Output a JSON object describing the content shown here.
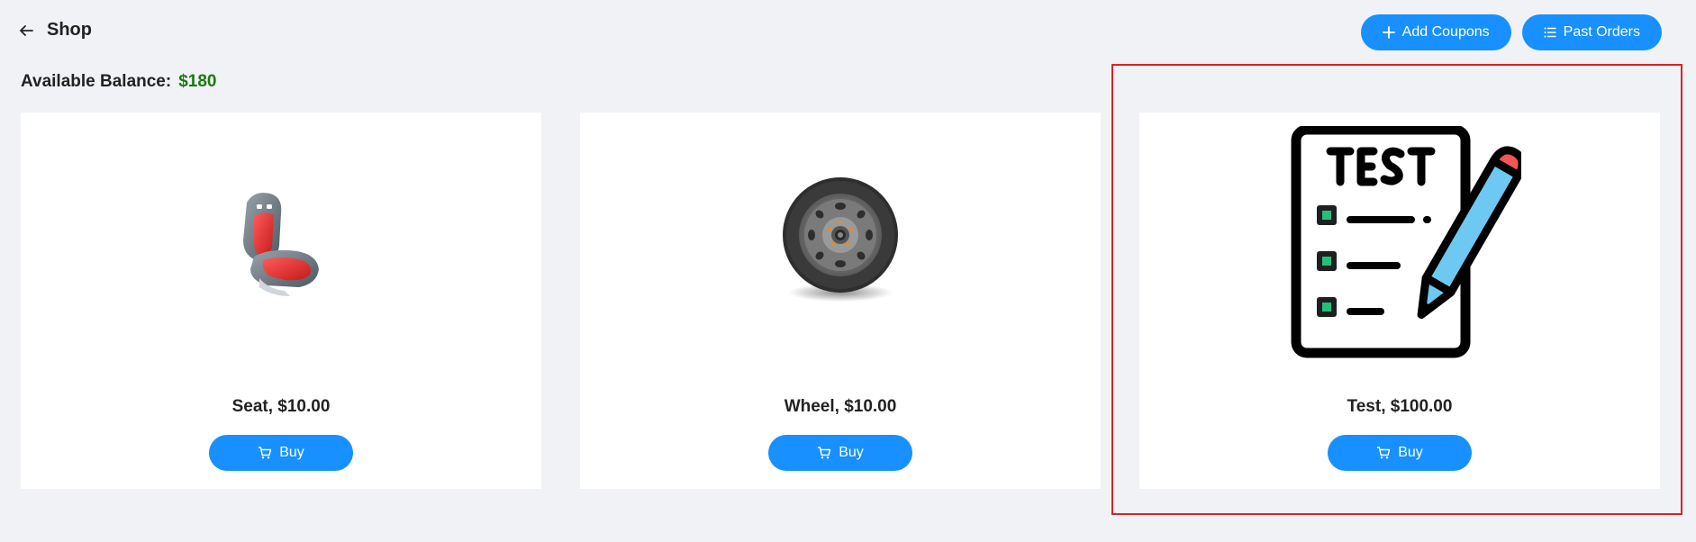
{
  "header": {
    "back_icon": "arrow-left-icon",
    "title": "Shop",
    "add_coupons_label": "Add Coupons",
    "add_coupons_icon": "plus-icon",
    "past_orders_label": "Past Orders",
    "past_orders_icon": "list-icon"
  },
  "balance": {
    "label": "Available Balance:",
    "amount": "$180"
  },
  "products": [
    {
      "title": "Seat, $10.00",
      "image_icon": "car-seat-icon",
      "buy_label": "Buy"
    },
    {
      "title": "Wheel, $10.00",
      "image_icon": "wheel-icon",
      "buy_label": "Buy"
    },
    {
      "title": "Test, $100.00",
      "image_icon": "test-checklist-icon",
      "buy_label": "Buy"
    }
  ],
  "colors": {
    "primary": "#1890ff",
    "balance": "#1a7a12",
    "highlight": "#e02020",
    "background": "#f0f2f5"
  }
}
